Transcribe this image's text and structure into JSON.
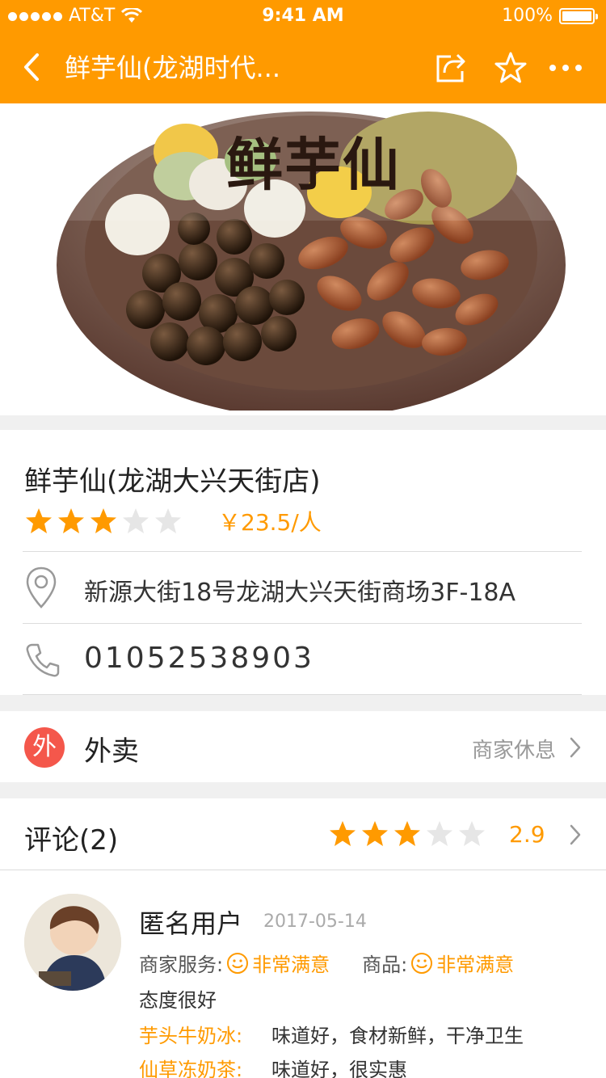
{
  "status_bar": {
    "carrier": "AT&T",
    "time": "9:41 AM",
    "battery": "100%"
  },
  "nav": {
    "title": "鲜芋仙(龙湖时代...",
    "back_icon": "chevron-left-icon",
    "share_icon": "share-icon",
    "favorite_icon": "star-outline-icon",
    "more_icon": "more-dots-icon"
  },
  "hero": {
    "brand": "鲜芋仙",
    "image_alt": "taro dessert bowl with beans and boba"
  },
  "shop": {
    "name": "鲜芋仙(龙湖大兴天街店)",
    "rating": 3,
    "rating_max": 5,
    "price": "￥23.5/人",
    "address": "新源大街18号龙湖大兴天街商场3F-18A",
    "phone": "01052538903"
  },
  "delivery": {
    "badge": "外",
    "label": "外卖",
    "status": "商家休息"
  },
  "reviews": {
    "title": "评论(2)",
    "rating": 3,
    "rating_max": 5,
    "score": "2.9",
    "items": [
      {
        "user": "匿名用户",
        "date": "2017-05-14",
        "service_label": "商家服务:",
        "service_value": "非常满意",
        "goods_label": "商品:",
        "goods_value": "非常满意",
        "comment": "态度很好",
        "dishes": [
          {
            "name": "芋头牛奶冰:",
            "desc": "味道好，食材新鲜，干净卫生"
          },
          {
            "name": "仙草冻奶茶:",
            "desc": "味道好，很实惠"
          }
        ]
      }
    ]
  },
  "colors": {
    "accent": "#ff9a00",
    "badge": "#f4574b",
    "star_off": "#e6e6e6"
  }
}
